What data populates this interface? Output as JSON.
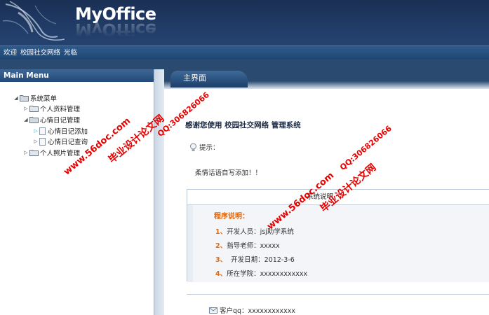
{
  "header": {
    "logo_text": "MyOffice"
  },
  "welcome_bar": {
    "words": [
      "欢迎",
      "校园社交网络",
      "光临"
    ]
  },
  "sidebar": {
    "title": "Main Menu",
    "tree": [
      {
        "label": "系统菜单",
        "level": 0,
        "kind": "folder-open"
      },
      {
        "label": "个人资料管理",
        "level": 1,
        "kind": "folder"
      },
      {
        "label": "心情日记管理",
        "level": 1,
        "kind": "folder-open"
      },
      {
        "label": "心情日记添加",
        "level": 2,
        "kind": "doc",
        "active": true
      },
      {
        "label": "心情日记查询",
        "level": 2,
        "kind": "doc"
      },
      {
        "label": "个人照片管理",
        "level": 1,
        "kind": "folder"
      }
    ]
  },
  "main": {
    "tab_label": "主界面",
    "title": "感谢您使用 校园社交网络 管理系统",
    "tip_label": "提示：",
    "motto": "柔情话语自写添加！！",
    "system_box": {
      "header": "系统说明",
      "program_label": "程序说明：",
      "rows": [
        {
          "num": "1、",
          "text": "开发人员：jsj助学系统"
        },
        {
          "num": "2、",
          "text": "指导老师：xxxxx"
        },
        {
          "num": "3、",
          "text": "  开发日期：2012-3-6"
        },
        {
          "num": "4、",
          "text": "所在学院：xxxxxxxxxxxx"
        }
      ]
    },
    "contact": "客户qq：xxxxxxxxxxxx"
  },
  "watermarks": {
    "site": "www.56doc.com",
    "qq": "QQ:306826066",
    "brand": "毕业设计论文网"
  },
  "colors": {
    "header_bg": "#1f3a63",
    "accent_orange": "#e06a12",
    "watermark_red": "#e60000",
    "tree_active_arrow": "#3ea6e0"
  }
}
